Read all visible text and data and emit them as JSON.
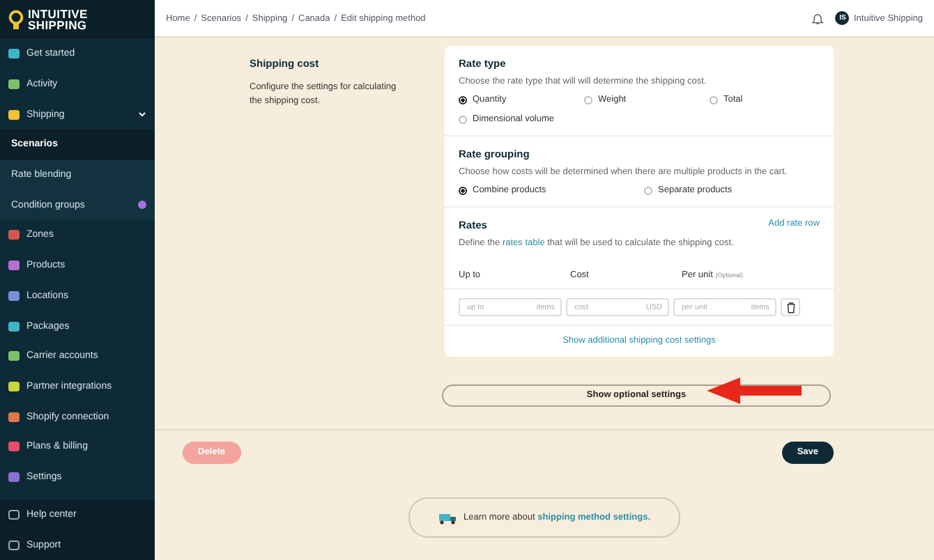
{
  "logo": {
    "line1": "INTUITIVE",
    "line2": "SHIPPING"
  },
  "sidebar": {
    "items": [
      {
        "label": "Get started",
        "selected": false
      },
      {
        "label": "Activity",
        "selected": false
      },
      {
        "label": "Shipping",
        "selected": false,
        "expanded": true,
        "children": [
          {
            "label": "Scenarios",
            "selected": true,
            "badge": false
          },
          {
            "label": "Rate blending",
            "selected": false,
            "badge": false
          },
          {
            "label": "Condition groups",
            "selected": false,
            "badge": true
          }
        ]
      },
      {
        "label": "Zones",
        "selected": false
      },
      {
        "label": "Products",
        "selected": false
      },
      {
        "label": "Locations",
        "selected": false
      },
      {
        "label": "Packages",
        "selected": false
      },
      {
        "label": "Carrier accounts",
        "selected": false
      },
      {
        "label": "Partner integrations",
        "selected": false
      },
      {
        "label": "Shopify connection",
        "selected": false
      },
      {
        "label": "Plans & billing",
        "selected": false
      },
      {
        "label": "Settings",
        "selected": false
      }
    ],
    "footer": [
      {
        "label": "Help center"
      },
      {
        "label": "Support"
      }
    ]
  },
  "breadcrumb": [
    "Home",
    "Scenarios",
    "Shipping",
    "Canada",
    "Edit shipping method"
  ],
  "breadcrumb_separator": "/",
  "user": {
    "initials": "IS",
    "name": "Intuitive Shipping"
  },
  "section": {
    "title": "Shipping cost",
    "description": "Configure the settings for calculating the shipping cost."
  },
  "rate_type": {
    "title": "Rate type",
    "description": "Choose the rate type that will will determine the shipping cost.",
    "options": [
      {
        "label": "Quantity",
        "selected": true
      },
      {
        "label": "Weight",
        "selected": false
      },
      {
        "label": "Total",
        "selected": false
      },
      {
        "label": "Dimensional volume",
        "selected": false
      }
    ]
  },
  "rate_grouping": {
    "title": "Rate grouping",
    "description": "Choose how costs will be determined when there are multiple products in the cart.",
    "options": [
      {
        "label": "Combine products",
        "selected": true
      },
      {
        "label": "Separate products",
        "selected": false
      }
    ]
  },
  "rates": {
    "title": "Rates",
    "add_link": "Add rate row",
    "description_before": "Define the",
    "description_link": "rates table",
    "description_after": "that will be used to calculate the shipping cost.",
    "columns": [
      {
        "label": "Up to"
      },
      {
        "label": "Cost"
      },
      {
        "label": "Per unit",
        "note": "(Optional)"
      }
    ],
    "row": [
      {
        "placeholder": "up to",
        "suffix": "items"
      },
      {
        "placeholder": "cost",
        "suffix": "USD"
      },
      {
        "placeholder": "per unit",
        "suffix": "items"
      }
    ],
    "more_link": "Show additional shipping cost settings"
  },
  "optional_button": "Show optional settings",
  "delete_button": {
    "label": "Delete",
    "disabled": true
  },
  "save_button": "Save",
  "learn_more": {
    "text": "Learn more about",
    "link": "shipping method settings."
  }
}
